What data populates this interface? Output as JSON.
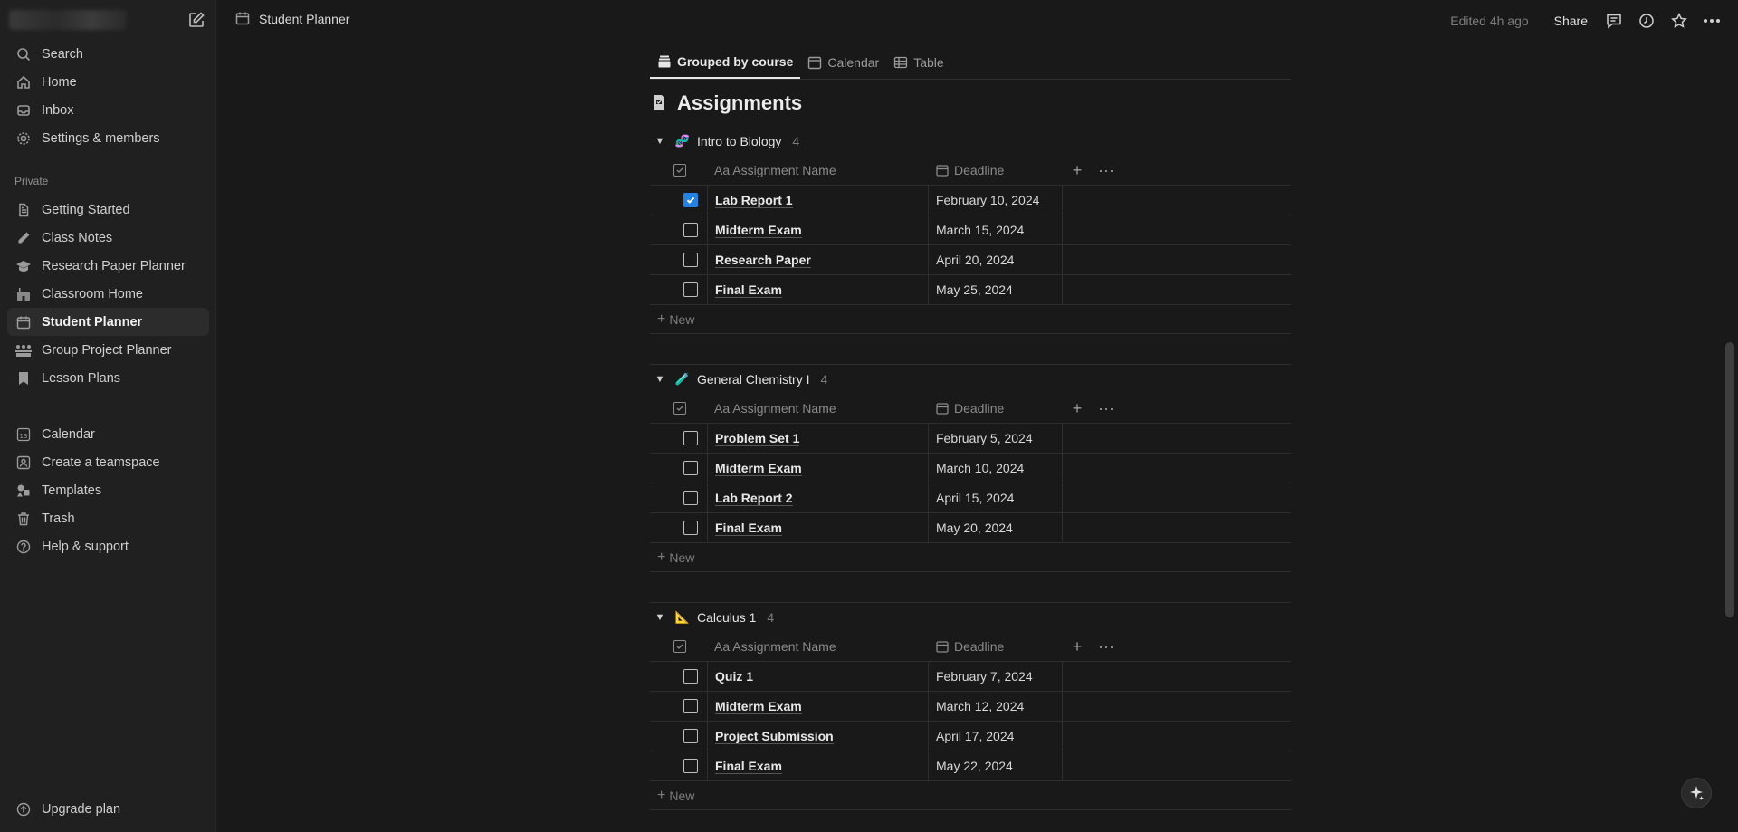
{
  "sidebar": {
    "top_items": [
      {
        "label": "Search",
        "icon": "search-icon"
      },
      {
        "label": "Home",
        "icon": "home-icon"
      },
      {
        "label": "Inbox",
        "icon": "inbox-icon"
      },
      {
        "label": "Settings & members",
        "icon": "gear-icon"
      }
    ],
    "private_label": "Private",
    "private_items": [
      {
        "label": "Getting Started",
        "icon": "document-icon"
      },
      {
        "label": "Class Notes",
        "icon": "pencil-icon"
      },
      {
        "label": "Research Paper Planner",
        "icon": "graduation-cap-icon"
      },
      {
        "label": "Classroom Home",
        "icon": "school-icon"
      },
      {
        "label": "Student Planner",
        "icon": "calendar-icon",
        "active": true
      },
      {
        "label": "Group Project Planner",
        "icon": "group-icon"
      },
      {
        "label": "Lesson Plans",
        "icon": "bookmark-icon"
      }
    ],
    "bottom_items": [
      {
        "label": "Calendar",
        "icon": "calendar-13-icon"
      },
      {
        "label": "Create a teamspace",
        "icon": "teamspace-icon"
      },
      {
        "label": "Templates",
        "icon": "shapes-icon"
      },
      {
        "label": "Trash",
        "icon": "trash-icon"
      },
      {
        "label": "Help & support",
        "icon": "help-icon"
      }
    ],
    "upgrade_label": "Upgrade plan"
  },
  "topbar": {
    "breadcrumb": "Student Planner",
    "edited": "Edited 4h ago",
    "share": "Share"
  },
  "tabs": [
    {
      "label": "Grouped by course",
      "active": true
    },
    {
      "label": "Calendar",
      "active": false
    },
    {
      "label": "Table",
      "active": false
    }
  ],
  "database_title": "Assignments",
  "columns": {
    "name": "Aa Assignment Name",
    "deadline": "Deadline"
  },
  "new_label": "New",
  "groups": [
    {
      "name": "Intro to Biology",
      "emoji": "🧬",
      "count": "4",
      "rows": [
        {
          "name": "Lab Report 1",
          "deadline": "February 10, 2024",
          "done": true
        },
        {
          "name": "Midterm Exam",
          "deadline": "March 15, 2024",
          "done": false
        },
        {
          "name": "Research Paper",
          "deadline": "April 20, 2024",
          "done": false
        },
        {
          "name": "Final Exam",
          "deadline": "May 25, 2024",
          "done": false
        }
      ]
    },
    {
      "name": "General Chemistry I",
      "emoji": "🧪",
      "count": "4",
      "rows": [
        {
          "name": "Problem Set 1",
          "deadline": "February 5, 2024",
          "done": false
        },
        {
          "name": "Midterm Exam",
          "deadline": "March 10, 2024",
          "done": false
        },
        {
          "name": "Lab Report 2",
          "deadline": "April 15, 2024",
          "done": false
        },
        {
          "name": "Final Exam",
          "deadline": "May 20, 2024",
          "done": false
        }
      ]
    },
    {
      "name": "Calculus 1",
      "emoji": "📐",
      "count": "4",
      "rows": [
        {
          "name": "Quiz 1",
          "deadline": "February 7, 2024",
          "done": false
        },
        {
          "name": "Midterm Exam",
          "deadline": "March 12, 2024",
          "done": false
        },
        {
          "name": "Project Submission",
          "deadline": "April 17, 2024",
          "done": false
        },
        {
          "name": "Final Exam",
          "deadline": "May 22, 2024",
          "done": false
        }
      ]
    }
  ],
  "colors": {
    "checkbox_checked": "#2383e2",
    "background": "#191919",
    "sidebar": "#202020"
  }
}
